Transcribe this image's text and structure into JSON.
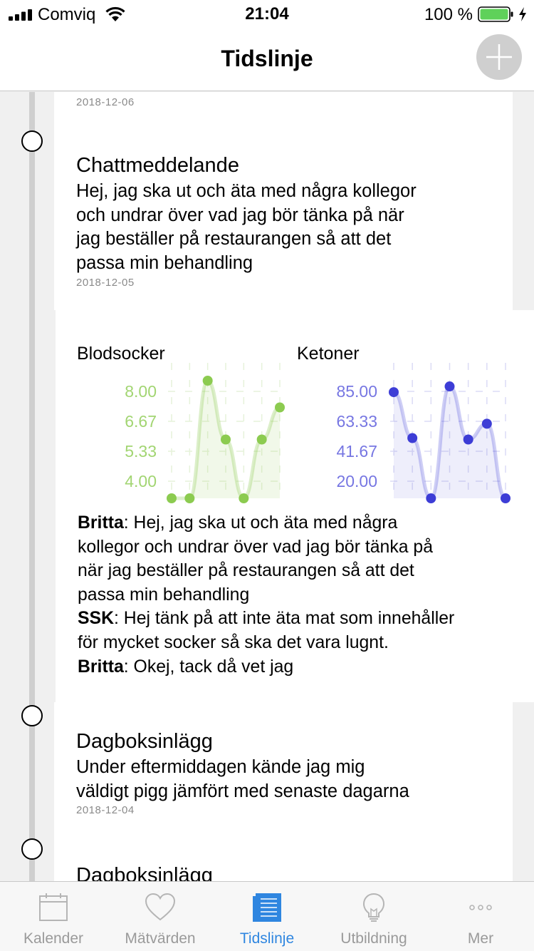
{
  "status": {
    "carrier": "Comviq",
    "time": "21:04",
    "battery": "100 %"
  },
  "nav": {
    "title": "Tidslinje"
  },
  "timeline": {
    "top_partial_date": "2018-12-06",
    "chat_entry": {
      "title": "Chattmeddelande",
      "lines": [
        "Hej, jag ska ut och äta med några kollegor",
        "och undrar över vad jag bör tänka på när",
        "jag beställer på restaurangen så att det",
        "passa min behandling"
      ],
      "date": "2018-12-05"
    },
    "conversation": {
      "messages": [
        {
          "sender": "Britta",
          "lines": [
            "Hej, jag ska ut och äta med några",
            "kollegor och undrar över vad jag bör tänka på",
            "när jag beställer på restaurangen så att det",
            "passa min behandling"
          ]
        },
        {
          "sender": "SSK",
          "lines": [
            "Hej tänk på att inte äta mat som innehåller",
            "för mycket socker så ska det vara lugnt."
          ]
        },
        {
          "sender": "Britta",
          "lines": [
            "Okej, tack då vet jag"
          ]
        }
      ]
    },
    "diary_entry": {
      "title": "Dagboksinlägg",
      "lines": [
        "Under eftermiddagen kände jag mig",
        "väldigt pigg jämfört med senaste dagarna"
      ],
      "date": "2018-12-04"
    },
    "next_entry": {
      "title": "Dagboksinlägg"
    }
  },
  "chart_data": [
    {
      "type": "line",
      "title": "Blodsocker",
      "y_ticks": [
        "8.00",
        "6.67",
        "5.33",
        "4.00"
      ],
      "ylim": [
        3.6,
        8.0
      ],
      "values": [
        3.6,
        3.6,
        8.0,
        5.8,
        3.6,
        5.8,
        7.0
      ],
      "color": "#8ccb50"
    },
    {
      "type": "line",
      "title": "Ketoner",
      "y_ticks": [
        "85.00",
        "63.33",
        "41.67",
        "20.00"
      ],
      "ylim": [
        10,
        92
      ],
      "values": [
        84,
        52,
        10,
        88,
        51,
        62,
        10
      ],
      "color": "#3d3dd6"
    }
  ],
  "tabs": [
    {
      "label": "Kalender",
      "icon": "calendar-icon"
    },
    {
      "label": "Mätvärden",
      "icon": "heart-icon"
    },
    {
      "label": "Tidslinje",
      "icon": "timeline-icon",
      "active": true
    },
    {
      "label": "Utbildning",
      "icon": "lightbulb-icon"
    },
    {
      "label": "Mer",
      "icon": "more-icon"
    }
  ],
  "colors": {
    "accent": "#2f86e0",
    "inactive": "#9a9a9a",
    "timeline_line": "#cfcfcf"
  }
}
